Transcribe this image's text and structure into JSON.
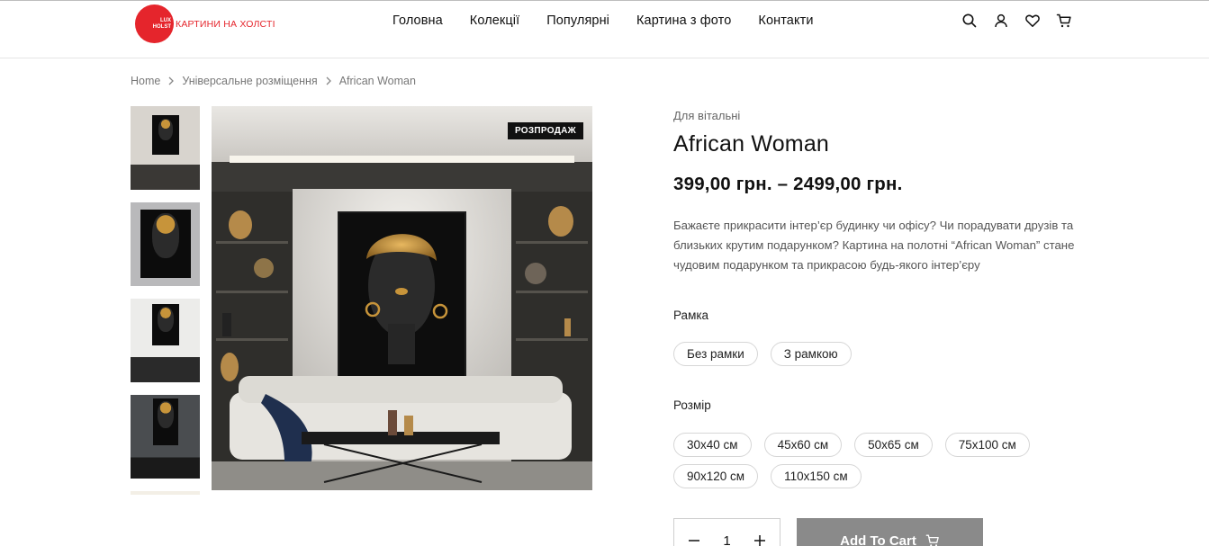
{
  "header": {
    "logo_badge_lines": [
      "LUX",
      "HOLST"
    ],
    "logo_text": "КАРТИНИ НА ХОЛСТІ",
    "nav": [
      "Головна",
      "Колекції",
      "Популярні",
      "Картина з фото",
      "Контакти"
    ],
    "icons": [
      "search-icon",
      "user-icon",
      "heart-icon",
      "cart-icon"
    ]
  },
  "breadcrumb": [
    "Home",
    "Універсальне розміщення",
    "African Woman"
  ],
  "gallery": {
    "badge": "РОЗПРОДАЖ"
  },
  "product": {
    "category": "Для вітальні",
    "title": "African Woman",
    "price": "399,00 грн. – 2499,00 грн.",
    "description": "Бажаєте прикрасити інтер’єр будинку чи офісу? Чи порадувати друзів та близьких крутим подарунком? Картина на полотні “African Woman” стане чудовим подарунком та прикрасою будь-якого інтер’єру",
    "frame_label": "Рамка",
    "frame_options": [
      "Без рамки",
      "З рамкою"
    ],
    "size_label": "Розмір",
    "size_options": [
      "30x40 см",
      "45x60 см",
      "50x65 см",
      "75x100 см",
      "90x120 см",
      "110x150 см"
    ],
    "quantity": "1",
    "add_to_cart": "Add To Cart"
  },
  "colors": {
    "brand_red": "#e5252c",
    "button_gray": "#8a8a8a",
    "badge_black": "#111111",
    "accent_gold": "#c7943a"
  }
}
